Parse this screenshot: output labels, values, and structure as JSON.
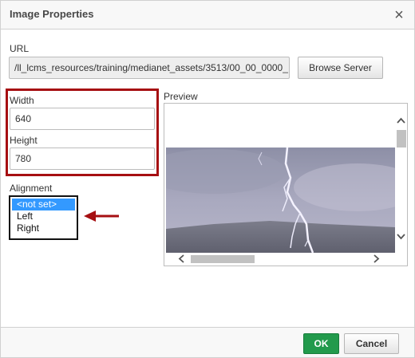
{
  "dialog": {
    "title": "Image Properties",
    "close_icon": "close-icon"
  },
  "url": {
    "label": "URL",
    "value": "/ll_lcms_resources/training/medianet_assets/3513/00_00_0000_",
    "browse_label": "Browse Server"
  },
  "dimensions": {
    "width_label": "Width",
    "width_value": "640",
    "height_label": "Height",
    "height_value": "780",
    "highlight_color": "#a60f12"
  },
  "alignment": {
    "label": "Alignment",
    "options": [
      "<not set>",
      "Left",
      "Right"
    ],
    "selected": "<not set>",
    "pointer_color": "#a60f12"
  },
  "preview": {
    "label": "Preview",
    "image_description_icon": "lightning-photo"
  },
  "footer": {
    "ok_label": "OK",
    "cancel_label": "Cancel",
    "ok_color": "#229a4c"
  }
}
